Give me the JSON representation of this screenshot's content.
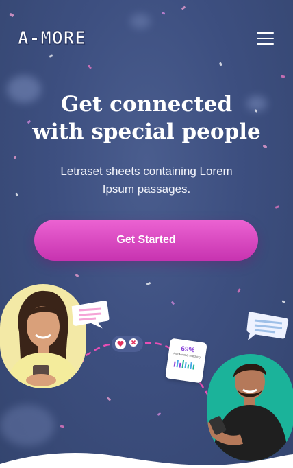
{
  "brand": {
    "logo_text": "A-MORE"
  },
  "hero": {
    "headline_line1": "Get connected",
    "headline_line2": "with special people",
    "subtext": "Letraset sheets containing Lorem Ipsum passages.",
    "cta_label": "Get Started"
  },
  "illustration": {
    "stat_percent": "69%",
    "stat_label": "AMI Monthly Matching"
  },
  "icons": {
    "menu": "hamburger-menu-icon",
    "heart": "heart-icon",
    "close": "close-icon"
  },
  "colors": {
    "background": "#3d4f80",
    "cta_gradient_top": "#ec63d2",
    "cta_gradient_bottom": "#c733b0",
    "accent_pink": "#e84fb5",
    "accent_teal": "#1bb39a",
    "text": "#ffffff"
  }
}
